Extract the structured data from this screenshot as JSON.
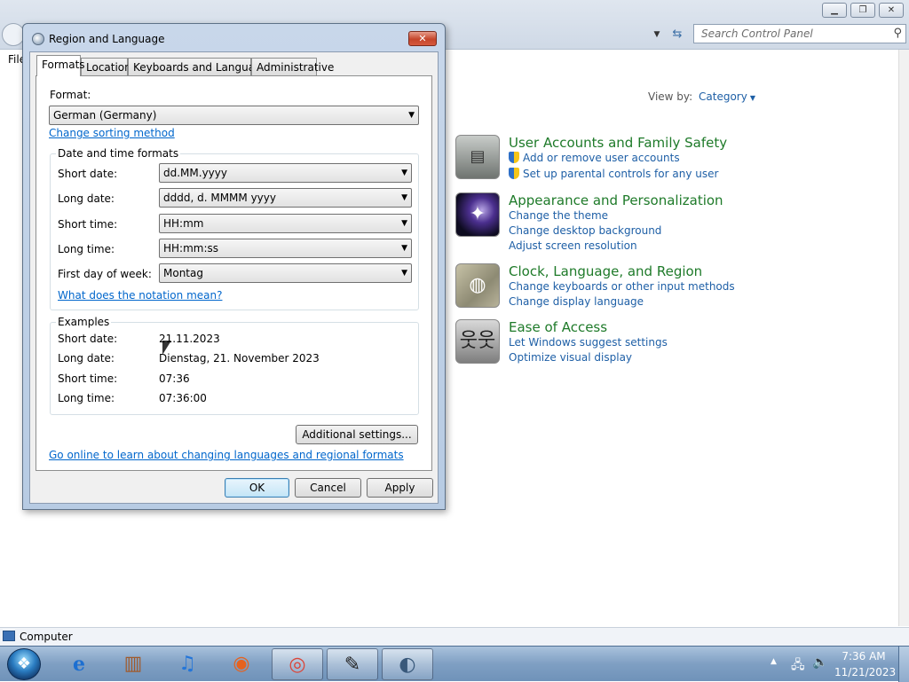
{
  "control_panel": {
    "search_placeholder": "Search Control Panel",
    "menu_file": "File",
    "view_by_label": "View by:",
    "view_by_value": "Category",
    "categories": [
      {
        "title": "User Accounts and Family Safety",
        "icon": "user-accounts-icon",
        "links": [
          "Add or remove user accounts",
          "Set up parental controls for any user"
        ]
      },
      {
        "title": "Appearance and Personalization",
        "icon": "appearance-icon",
        "links": [
          "Change the theme",
          "Change desktop background",
          "Adjust screen resolution"
        ]
      },
      {
        "title": "Clock, Language, and Region",
        "icon": "clock-language-region-icon",
        "links": [
          "Change keyboards or other input methods",
          "Change display language"
        ]
      },
      {
        "title": "Ease of Access",
        "icon": "ease-of-access-icon",
        "links": [
          "Let Windows suggest settings",
          "Optimize visual display"
        ]
      }
    ]
  },
  "dialog": {
    "title": "Region and Language",
    "tabs": [
      "Formats",
      "Location",
      "Keyboards and Languages",
      "Administrative"
    ],
    "active_tab": "Formats",
    "format_label": "Format:",
    "format_value": "German (Germany)",
    "change_sorting_link": "Change sorting method",
    "date_time_group": "Date and time formats",
    "fields": {
      "short_date": {
        "label": "Short date:",
        "value": "dd.MM.yyyy"
      },
      "long_date": {
        "label": "Long date:",
        "value": "dddd, d. MMMM yyyy"
      },
      "short_time": {
        "label": "Short time:",
        "value": "HH:mm"
      },
      "long_time": {
        "label": "Long time:",
        "value": "HH:mm:ss"
      },
      "first_day": {
        "label": "First day of week:",
        "value": "Montag"
      }
    },
    "notation_link": "What does the notation mean?",
    "examples_group": "Examples",
    "examples": {
      "short_date": {
        "label": "Short date:",
        "value": "21.11.2023"
      },
      "long_date": {
        "label": "Long date:",
        "value": "Dienstag, 21. November 2023"
      },
      "short_time": {
        "label": "Short time:",
        "value": "07:36"
      },
      "long_time": {
        "label": "Long time:",
        "value": "07:36:00"
      }
    },
    "additional_settings_button": "Additional settings...",
    "online_link": "Go online to learn about changing languages and regional formats",
    "ok_button": "OK",
    "cancel_button": "Cancel",
    "apply_button": "Apply"
  },
  "statusbar": {
    "text": "Computer"
  },
  "taskbar": {
    "apps": [
      "start-orb",
      "internet-explorer-icon",
      "windows-explorer-icon",
      "itunes-icon",
      "firefox-icon",
      "chrome-icon",
      "paint-icon",
      "region-language-icon"
    ],
    "time": "7:36 AM",
    "date": "11/21/2023"
  }
}
